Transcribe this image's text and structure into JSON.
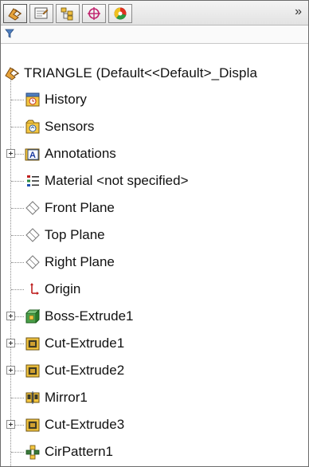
{
  "toolbar": {
    "tabs": [
      {
        "icon": "feature-manager-icon",
        "active": true
      },
      {
        "icon": "property-manager-icon",
        "active": false
      },
      {
        "icon": "configuration-manager-icon",
        "active": false
      },
      {
        "icon": "dimxpert-manager-icon",
        "active": false
      },
      {
        "icon": "display-manager-icon",
        "active": false
      }
    ],
    "more_label": "»"
  },
  "filter": {
    "icon": "filter-icon"
  },
  "tree": {
    "root": {
      "label": "TRIANGLE  (Default<<Default>_Displa",
      "icon": "part-icon"
    },
    "items": [
      {
        "label": "History",
        "icon": "history-icon",
        "expandable": false
      },
      {
        "label": "Sensors",
        "icon": "sensors-icon",
        "expandable": false
      },
      {
        "label": "Annotations",
        "icon": "annotations-icon",
        "expandable": true
      },
      {
        "label": "Material <not specified>",
        "icon": "material-icon",
        "expandable": false
      },
      {
        "label": "Front Plane",
        "icon": "plane-icon",
        "expandable": false
      },
      {
        "label": "Top Plane",
        "icon": "plane-icon",
        "expandable": false
      },
      {
        "label": "Right Plane",
        "icon": "plane-icon",
        "expandable": false
      },
      {
        "label": "Origin",
        "icon": "origin-icon",
        "expandable": false
      },
      {
        "label": "Boss-Extrude1",
        "icon": "boss-extrude-icon",
        "expandable": true
      },
      {
        "label": "Cut-Extrude1",
        "icon": "cut-extrude-icon",
        "expandable": true
      },
      {
        "label": "Cut-Extrude2",
        "icon": "cut-extrude-icon",
        "expandable": true
      },
      {
        "label": "Mirror1",
        "icon": "mirror-icon",
        "expandable": false
      },
      {
        "label": "Cut-Extrude3",
        "icon": "cut-extrude-icon",
        "expandable": true
      },
      {
        "label": "CirPattern1",
        "icon": "circular-pattern-icon",
        "expandable": false
      }
    ]
  }
}
